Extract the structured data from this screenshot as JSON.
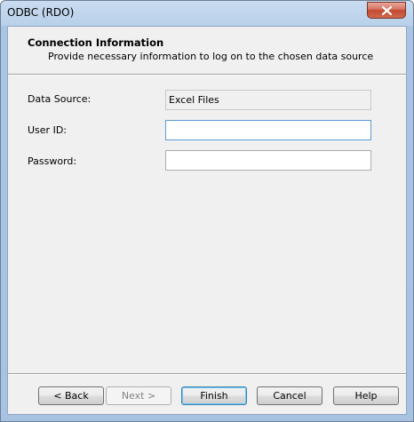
{
  "window": {
    "title": "ODBC (RDO)"
  },
  "header": {
    "title": "Connection Information",
    "subtitle": "Provide necessary information to log on to the chosen data source"
  },
  "form": {
    "data_source_label": "Data Source:",
    "data_source_value": "Excel Files",
    "user_id_label": "User ID:",
    "user_id_value": "",
    "password_label": "Password:",
    "password_value": ""
  },
  "buttons": {
    "back": "< Back",
    "next": "Next >",
    "finish": "Finish",
    "cancel": "Cancel",
    "help": "Help"
  },
  "icons": {
    "close": "close-icon"
  }
}
